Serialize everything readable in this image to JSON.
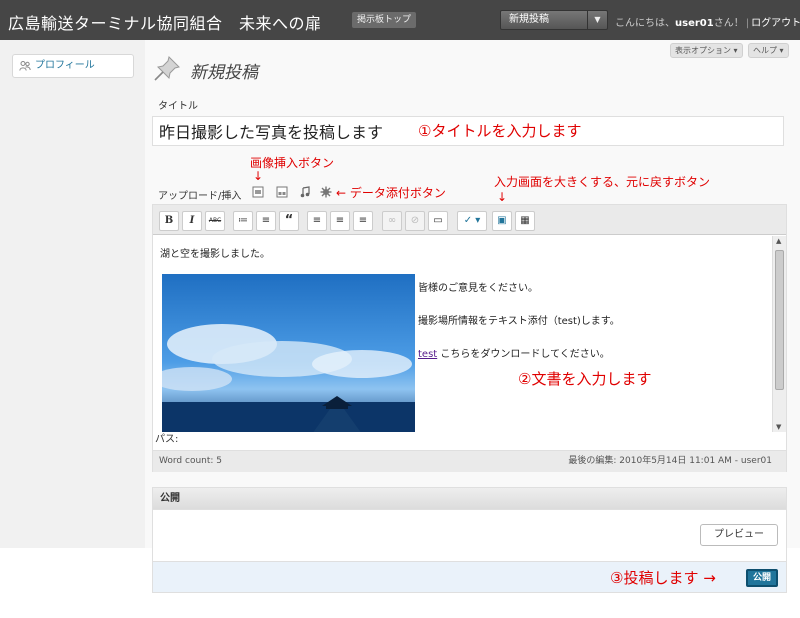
{
  "header": {
    "site_title": "広島輸送ターミナル協同組合　未来への扉",
    "board_top": "掲示板トップ",
    "new_post_select": "新規投稿",
    "greeting_prefix": "こんにちは、",
    "user_name": "user01",
    "greeting_suffix": "さん！",
    "separator": "|",
    "logout": "ログアウト"
  },
  "sidebar": {
    "items": [
      {
        "label": "プロフィール",
        "icon": "people-icon"
      }
    ]
  },
  "screen_options": {
    "display_options": "表示オプション ▾",
    "help": "ヘルプ ▾"
  },
  "page": {
    "title": "新規投稿"
  },
  "title_field": {
    "label": "タイトル",
    "value": "昨日撮影した写真を投稿します"
  },
  "upload": {
    "label": "アップロード/挿入"
  },
  "annotations": {
    "title_note": "①タイトルを入力します",
    "image_note": "画像挿入ボタン",
    "down_arrow": "↓",
    "attach_note": "← データ添付ボタン",
    "fullscreen_note": "入力画面を大きくする、元に戻すボタン",
    "body_note": "②文書を入力します",
    "publish_note": "③投稿します →"
  },
  "toolbar": {
    "buttons": [
      {
        "name": "bold-button",
        "label": "B"
      },
      {
        "name": "italic-button",
        "label": "I"
      },
      {
        "name": "strikethrough-button",
        "label": "ABC"
      },
      {
        "name": "bullet-list-button",
        "label": "≔"
      },
      {
        "name": "numbered-list-button",
        "label": "≡"
      },
      {
        "name": "blockquote-button",
        "label": "“"
      },
      {
        "name": "align-left-button",
        "label": "≡"
      },
      {
        "name": "align-center-button",
        "label": "≡"
      },
      {
        "name": "align-right-button",
        "label": "≡"
      },
      {
        "name": "link-button",
        "label": "∞"
      },
      {
        "name": "unlink-button",
        "label": "⊘"
      },
      {
        "name": "more-tag-button",
        "label": "▭"
      },
      {
        "name": "spellcheck-button",
        "label": "✓ ▾"
      },
      {
        "name": "fullscreen-button",
        "label": "▣"
      },
      {
        "name": "kitchen-sink-button",
        "label": "▦"
      }
    ]
  },
  "editor": {
    "line1": "湖と空を撮影しました。",
    "line2": "皆様のご意見をください。",
    "line3": "撮影場所情報をテキスト添付（test)します。",
    "link_text": "test",
    "link_after": "こちらをダウンロードしてください。",
    "path_label": "パス:",
    "word_count": "Word count: 5",
    "last_edit": "最後の編集: 2010年5月14日 11:01 AM - user01"
  },
  "publish": {
    "title": "公開",
    "preview": "プレビュー",
    "publish": "公開"
  },
  "colors": {
    "header_bg": "#464646",
    "annotation": "#e00000",
    "link": "#21759b",
    "publish_btn": "#21759b"
  }
}
